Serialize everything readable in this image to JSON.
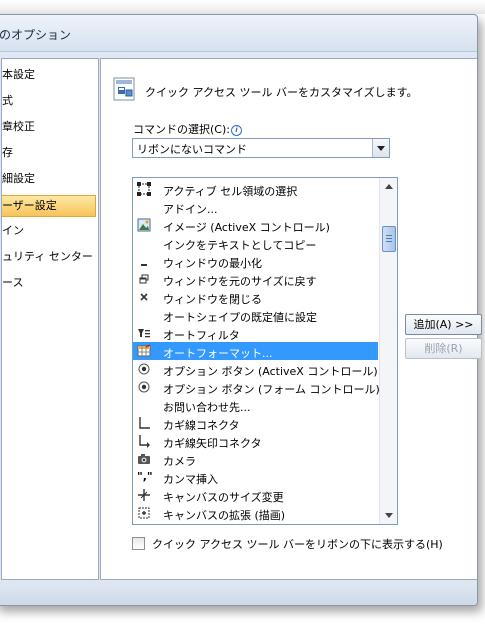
{
  "window": {
    "title": "のオプション"
  },
  "sidebar": {
    "items": [
      {
        "label": "本設定"
      },
      {
        "label": "式"
      },
      {
        "label": "章校正"
      },
      {
        "label": "存"
      },
      {
        "label": "細設定"
      },
      {
        "label": "ーザー設定",
        "selected": true
      },
      {
        "label": "イン"
      },
      {
        "label": "ュリティ センター"
      },
      {
        "label": "ース"
      }
    ]
  },
  "main": {
    "header_title": "クイック アクセス ツール バーをカスタマイズします。",
    "choose_label": "コマンドの選択(C):",
    "combo_value": "リボンにないコマンド",
    "commands": [
      {
        "label": "アクティブ セル領域の選択",
        "icon": "select-range-icon"
      },
      {
        "label": "アドイン...",
        "icon": ""
      },
      {
        "label": "イメージ (ActiveX コントロール)",
        "icon": "image-control-icon"
      },
      {
        "label": "インクをテキストとしてコピー",
        "icon": ""
      },
      {
        "label": "ウィンドウの最小化",
        "icon": "minimize-icon"
      },
      {
        "label": "ウィンドウを元のサイズに戻す",
        "icon": "restore-icon"
      },
      {
        "label": "ウィンドウを閉じる",
        "icon": "close-icon"
      },
      {
        "label": "オートシェイプの既定値に設定",
        "icon": ""
      },
      {
        "label": "オートフィルタ",
        "icon": "autofilter-icon"
      },
      {
        "label": "オートフォーマット...",
        "icon": "autoformat-icon",
        "selected": true
      },
      {
        "label": "オプション ボタン (ActiveX コントロール)",
        "icon": "option-button-icon"
      },
      {
        "label": "オプション ボタン (フォーム コントロール)",
        "icon": "option-button-icon"
      },
      {
        "label": "お問い合わせ先...",
        "icon": ""
      },
      {
        "label": "カギ線コネクタ",
        "icon": "elbow-connector-icon"
      },
      {
        "label": "カギ線矢印コネクタ",
        "icon": "elbow-arrow-connector-icon"
      },
      {
        "label": "カメラ",
        "icon": "camera-icon"
      },
      {
        "label": "カンマ挿入",
        "icon": "comma-icon"
      },
      {
        "label": "キャンバスのサイズ変更",
        "icon": "canvas-resize-icon"
      },
      {
        "label": "キャンバスの拡張 (描画)",
        "icon": "canvas-expand-icon"
      }
    ],
    "add_button": "追加(A) >>",
    "remove_button": "削除(R)",
    "checkbox_label": "クイック アクセス ツール バーをリボンの下に表示する(H)",
    "checkbox_checked": false
  }
}
